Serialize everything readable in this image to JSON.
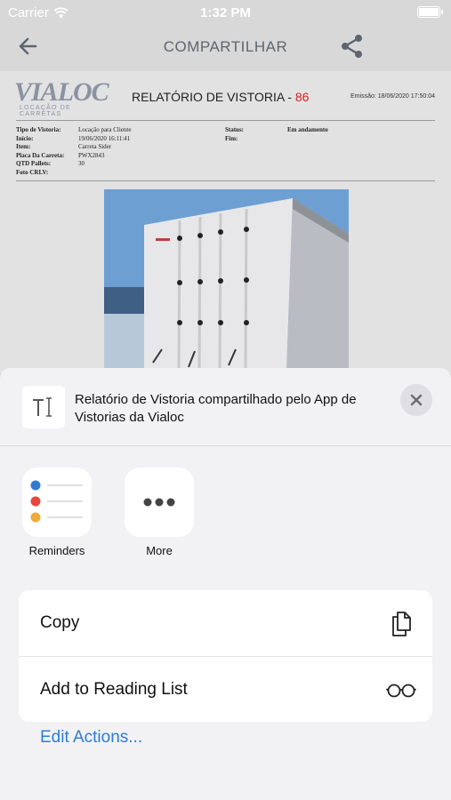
{
  "status_bar": {
    "carrier": "Carrier",
    "time": "1:32 PM"
  },
  "nav": {
    "title": "COMPARTILHAR"
  },
  "document": {
    "logo_brand": "VIALOC",
    "logo_sub": "LOCAÇÃO DE CARRETAS",
    "report_title": "RELATÓRIO DE VISTORIA - ",
    "report_number": "86",
    "emission": "Emissão: 18/06/2020 17:50:04",
    "fields": [
      {
        "label": "Tipo de Vistoria:",
        "value": "Locação para Cliente",
        "label2": "Status:",
        "value2": "Em andamento"
      },
      {
        "label": "Início:",
        "value": "19/06/2020 16:11:41",
        "label2": "Fim:",
        "value2": ""
      },
      {
        "label": "Item:",
        "value": "Carreta Sider",
        "label2": "",
        "value2": ""
      },
      {
        "label": "Placa Da Carreta:",
        "value": "PWX2843",
        "label2": "",
        "value2": ""
      },
      {
        "label": "QTD Pallets:",
        "value": "30",
        "label2": "",
        "value2": ""
      },
      {
        "label": "Foto CRLV:",
        "value": "",
        "label2": "",
        "value2": ""
      }
    ]
  },
  "share_sheet": {
    "message": "Relatório de Vistoria compartilhado pelo App de Vistorias da Vialoc",
    "preview_icon": "text-document-icon",
    "apps": [
      {
        "label": "Reminders",
        "icon": "reminders-icon"
      },
      {
        "label": "More",
        "icon": "more-dots-icon"
      }
    ],
    "actions": [
      {
        "label": "Copy",
        "icon": "copy-icon"
      },
      {
        "label": "Add to Reading List",
        "icon": "reading-glasses-icon"
      }
    ],
    "edit_actions": "Edit Actions..."
  },
  "colors": {
    "accent": "#2f7bd4",
    "report_number": "#d42020",
    "reminder_dots": [
      "#2f7bd4",
      "#e8453c",
      "#f2a93b"
    ]
  }
}
